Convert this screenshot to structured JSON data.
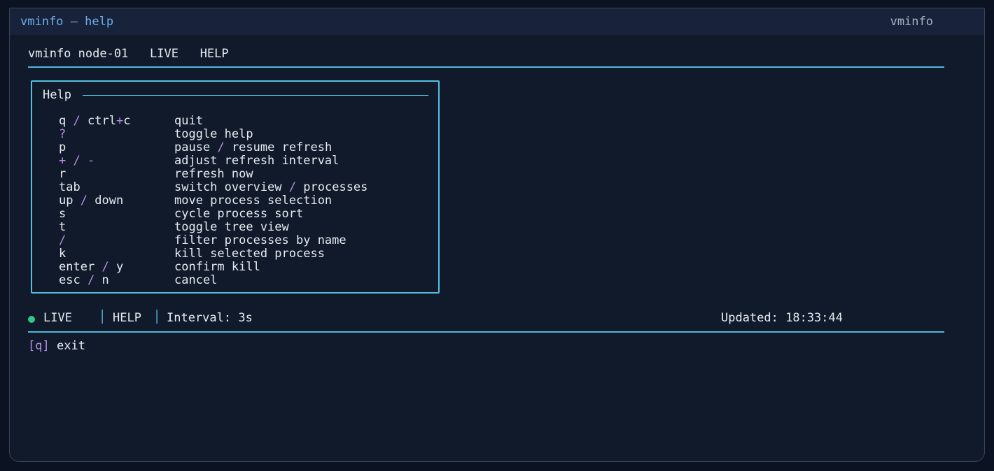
{
  "window": {
    "title": "vminfo — help",
    "app_name": "vminfo"
  },
  "header": {
    "host": "vminfo node-01",
    "state": "LIVE",
    "view": "HELP"
  },
  "help": {
    "title": "Help",
    "rows": [
      {
        "key": [
          "q",
          "/",
          "ctrl",
          "+",
          "c"
        ],
        "desc": [
          "quit"
        ]
      },
      {
        "key": [
          "?"
        ],
        "desc": [
          "toggle help"
        ]
      },
      {
        "key": [
          "p"
        ],
        "desc": [
          "pause",
          "/",
          "resume refresh"
        ]
      },
      {
        "key": [
          "+",
          "/",
          "-"
        ],
        "desc": [
          "adjust refresh interval"
        ]
      },
      {
        "key": [
          "r"
        ],
        "desc": [
          "refresh now"
        ]
      },
      {
        "key": [
          "tab"
        ],
        "desc": [
          "switch overview",
          "/",
          "processes"
        ]
      },
      {
        "key": [
          "up",
          "/",
          "down"
        ],
        "desc": [
          "move process selection"
        ]
      },
      {
        "key": [
          "s"
        ],
        "desc": [
          "cycle process sort"
        ]
      },
      {
        "key": [
          "t"
        ],
        "desc": [
          "toggle tree view"
        ]
      },
      {
        "key": [
          "/"
        ],
        "desc": [
          "filter processes by name"
        ]
      },
      {
        "key": [
          "k"
        ],
        "desc": [
          "kill selected process"
        ]
      },
      {
        "key": [
          "enter",
          "/",
          "y"
        ],
        "desc": [
          "confirm kill"
        ]
      },
      {
        "key": [
          "esc",
          "/",
          "n"
        ],
        "desc": [
          "cancel"
        ]
      }
    ]
  },
  "status": {
    "state": "LIVE",
    "mode": "HELP",
    "interval": "Interval: 3s",
    "updated": "Updated: 18:33:44",
    "separator": "│"
  },
  "footer": {
    "key": "q",
    "label": "exit"
  },
  "colors": {
    "accent": "#54bfe0",
    "separator": "#b58ee6",
    "live_dot": "#2ec98a",
    "title": "#6fb0ee"
  }
}
